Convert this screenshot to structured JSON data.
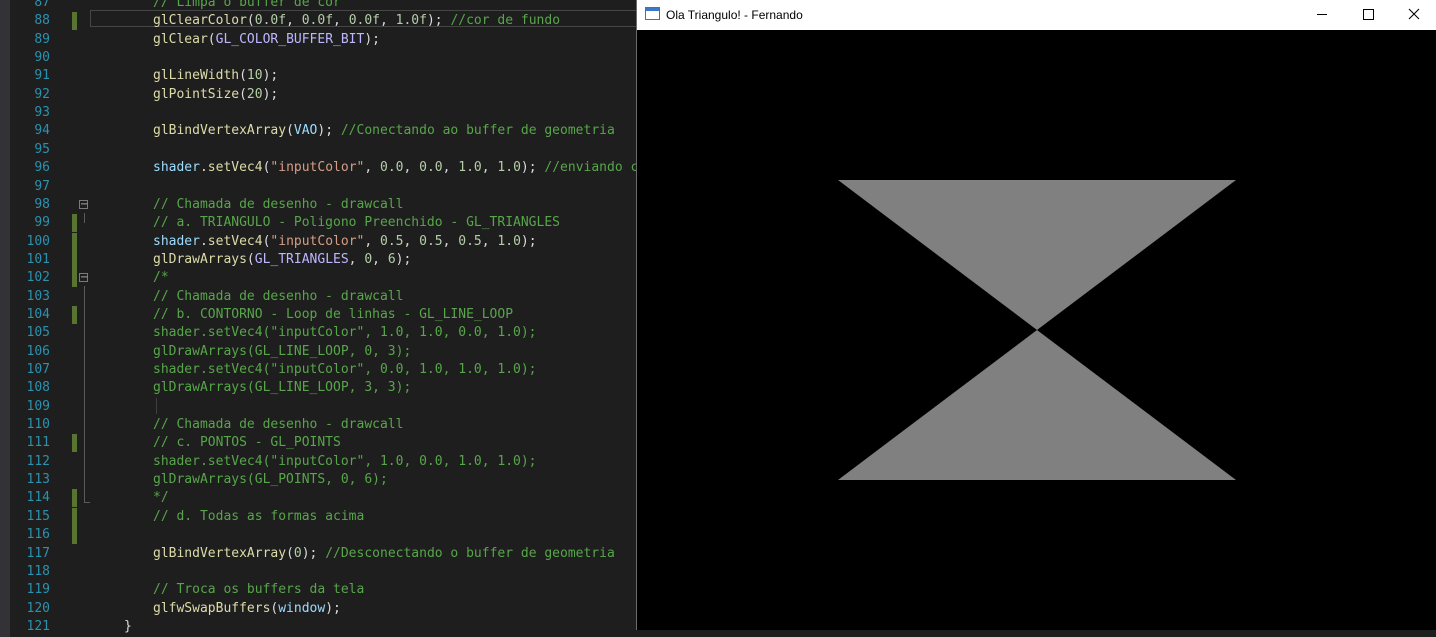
{
  "editor": {
    "lines": [
      {
        "n": "87",
        "tokens": [
          [
            "c",
            "// Limpa o buffer de cor"
          ]
        ]
      },
      {
        "n": "88",
        "tokens": [
          [
            "f",
            "glClearColor"
          ],
          [
            "d",
            "("
          ],
          [
            "n",
            "0.0f"
          ],
          [
            "d",
            ", "
          ],
          [
            "n",
            "0.0f"
          ],
          [
            "d",
            ", "
          ],
          [
            "n",
            "0.0f"
          ],
          [
            "d",
            ", "
          ],
          [
            "n",
            "1.0f"
          ],
          [
            "d",
            "); "
          ],
          [
            "c",
            "//cor de fundo"
          ]
        ]
      },
      {
        "n": "89",
        "tokens": [
          [
            "f",
            "glClear"
          ],
          [
            "d",
            "("
          ],
          [
            "m",
            "GL_COLOR_BUFFER_BIT"
          ],
          [
            "d",
            ");"
          ]
        ]
      },
      {
        "n": "90",
        "tokens": []
      },
      {
        "n": "91",
        "tokens": [
          [
            "f",
            "glLineWidth"
          ],
          [
            "d",
            "("
          ],
          [
            "n",
            "10"
          ],
          [
            "d",
            ");"
          ]
        ]
      },
      {
        "n": "92",
        "tokens": [
          [
            "f",
            "glPointSize"
          ],
          [
            "d",
            "("
          ],
          [
            "n",
            "20"
          ],
          [
            "d",
            ");"
          ]
        ]
      },
      {
        "n": "93",
        "tokens": []
      },
      {
        "n": "94",
        "tokens": [
          [
            "f",
            "glBindVertexArray"
          ],
          [
            "d",
            "("
          ],
          [
            "v",
            "VAO"
          ],
          [
            "d",
            "); "
          ],
          [
            "c",
            "//Conectando ao buffer de geometria"
          ]
        ]
      },
      {
        "n": "95",
        "tokens": []
      },
      {
        "n": "96",
        "tokens": [
          [
            "v",
            "shader"
          ],
          [
            "d",
            "."
          ],
          [
            "f",
            "setVec4"
          ],
          [
            "d",
            "("
          ],
          [
            "s",
            "\"inputColor\""
          ],
          [
            "d",
            ", "
          ],
          [
            "n",
            "0.0"
          ],
          [
            "d",
            ", "
          ],
          [
            "n",
            "0.0"
          ],
          [
            "d",
            ", "
          ],
          [
            "n",
            "1.0"
          ],
          [
            "d",
            ", "
          ],
          [
            "n",
            "1.0"
          ],
          [
            "d",
            "); "
          ],
          [
            "c",
            "//enviando co"
          ]
        ]
      },
      {
        "n": "97",
        "tokens": []
      },
      {
        "n": "98",
        "tokens": [
          [
            "c",
            "// Chamada de desenho - drawcall"
          ]
        ]
      },
      {
        "n": "99",
        "tokens": [
          [
            "c",
            "// a. TRIANGULO - Poligono Preenchido - GL_TRIANGLES"
          ]
        ]
      },
      {
        "n": "100",
        "tokens": [
          [
            "v",
            "shader"
          ],
          [
            "d",
            "."
          ],
          [
            "f",
            "setVec4"
          ],
          [
            "d",
            "("
          ],
          [
            "s",
            "\"inputColor\""
          ],
          [
            "d",
            ", "
          ],
          [
            "n",
            "0.5"
          ],
          [
            "d",
            ", "
          ],
          [
            "n",
            "0.5"
          ],
          [
            "d",
            ", "
          ],
          [
            "n",
            "0.5"
          ],
          [
            "d",
            ", "
          ],
          [
            "n",
            "1.0"
          ],
          [
            "d",
            ");"
          ]
        ]
      },
      {
        "n": "101",
        "tokens": [
          [
            "f",
            "glDrawArrays"
          ],
          [
            "d",
            "("
          ],
          [
            "m",
            "GL_TRIANGLES"
          ],
          [
            "d",
            ", "
          ],
          [
            "n",
            "0"
          ],
          [
            "d",
            ", "
          ],
          [
            "n",
            "6"
          ],
          [
            "d",
            ");"
          ]
        ]
      },
      {
        "n": "102",
        "tokens": [
          [
            "c",
            "/*"
          ]
        ]
      },
      {
        "n": "103",
        "tokens": [
          [
            "c",
            "// Chamada de desenho - drawcall"
          ]
        ]
      },
      {
        "n": "104",
        "tokens": [
          [
            "c",
            "// b. CONTORNO - Loop de linhas - GL_LINE_LOOP"
          ]
        ]
      },
      {
        "n": "105",
        "tokens": [
          [
            "c",
            "shader.setVec4(\"inputColor\", 1.0, 1.0, 0.0, 1.0);"
          ]
        ]
      },
      {
        "n": "106",
        "tokens": [
          [
            "c",
            "glDrawArrays(GL_LINE_LOOP, 0, 3);"
          ]
        ]
      },
      {
        "n": "107",
        "tokens": [
          [
            "c",
            "shader.setVec4(\"inputColor\", 0.0, 1.0, 1.0, 1.0);"
          ]
        ]
      },
      {
        "n": "108",
        "tokens": [
          [
            "c",
            "glDrawArrays(GL_LINE_LOOP, 3, 3);"
          ]
        ]
      },
      {
        "n": "109",
        "tokens": []
      },
      {
        "n": "110",
        "tokens": [
          [
            "c",
            "// Chamada de desenho - drawcall"
          ]
        ]
      },
      {
        "n": "111",
        "tokens": [
          [
            "c",
            "// c. PONTOS - GL_POINTS"
          ]
        ]
      },
      {
        "n": "112",
        "tokens": [
          [
            "c",
            "shader.setVec4(\"inputColor\", 1.0, 0.0, 1.0, 1.0);"
          ]
        ]
      },
      {
        "n": "113",
        "tokens": [
          [
            "c",
            "glDrawArrays(GL_POINTS, 0, 6);"
          ]
        ]
      },
      {
        "n": "114",
        "tokens": [
          [
            "c",
            "*/"
          ]
        ]
      },
      {
        "n": "115",
        "tokens": [
          [
            "c",
            "// d. Todas as formas acima"
          ]
        ]
      },
      {
        "n": "116",
        "tokens": []
      },
      {
        "n": "117",
        "tokens": [
          [
            "f",
            "glBindVertexArray"
          ],
          [
            "d",
            "("
          ],
          [
            "n",
            "0"
          ],
          [
            "d",
            "); "
          ],
          [
            "c",
            "//Desconectando o buffer de geometria"
          ]
        ]
      },
      {
        "n": "118",
        "tokens": []
      },
      {
        "n": "119",
        "tokens": [
          [
            "c",
            "// Troca os buffers da tela"
          ]
        ]
      },
      {
        "n": "120",
        "tokens": [
          [
            "f",
            "glfwSwapBuffers"
          ],
          [
            "d",
            "("
          ],
          [
            "v",
            "window"
          ],
          [
            "d",
            ");"
          ]
        ]
      },
      {
        "n": "121",
        "tokens": [
          [
            "d",
            "}"
          ]
        ]
      }
    ],
    "changed_lines": [
      "88",
      "99",
      "100",
      "101",
      "102",
      "104",
      "111",
      "114",
      "115",
      "116"
    ],
    "fold_markers": [
      "98",
      "102"
    ]
  },
  "window": {
    "title": "Ola Triangulo! - Fernando",
    "icons": [
      "app-window-icon",
      "minimize-icon",
      "maximize-icon",
      "close-icon"
    ],
    "background_color": "#000000",
    "shape_color": "#808080"
  }
}
